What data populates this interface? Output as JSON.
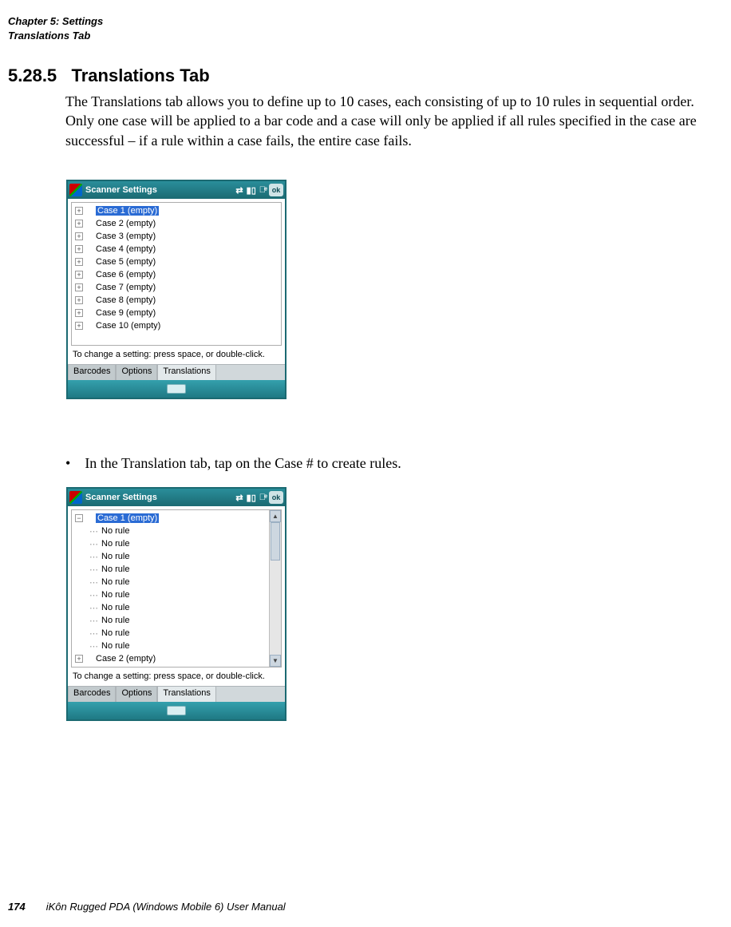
{
  "header": {
    "chapter": "Chapter 5:  Settings",
    "section": "Translations Tab"
  },
  "heading": {
    "number": "5.28.5",
    "title": "Translations Tab"
  },
  "body": "The Translations tab allows you to define up to 10 cases, each consisting of up to 10 rules in sequential order. Only one case will be applied to a bar code and a case will only be applied if all rules specified in the case are successful – if a rule within a case fails, the entire case fails.",
  "screenshot_common": {
    "titlebar": "Scanner Settings",
    "ok": "ok",
    "hint": "To change a setting: press space, or double-click.",
    "tabs": [
      "Barcodes",
      "Options",
      "Translations"
    ]
  },
  "screenshot1": {
    "selected": "Case 1 (empty)",
    "cases": [
      "Case 2 (empty)",
      "Case 3 (empty)",
      "Case 4 (empty)",
      "Case 5 (empty)",
      "Case 6 (empty)",
      "Case 7 (empty)",
      "Case 8 (empty)",
      "Case 9 (empty)",
      "Case 10 (empty)"
    ]
  },
  "bullet": "In the Translation tab, tap on the Case # to create rules.",
  "screenshot2": {
    "selected": "Case 1 (empty)",
    "norule": "No rule",
    "bottom_case": "Case 2 (empty)"
  },
  "footer": {
    "page": "174",
    "title": "iKôn Rugged PDA (Windows Mobile 6) User Manual"
  }
}
